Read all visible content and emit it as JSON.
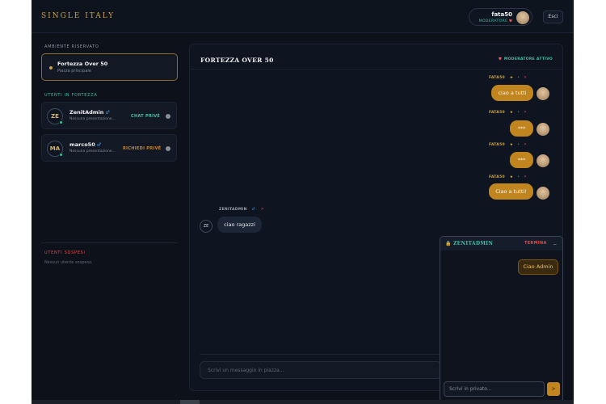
{
  "header": {
    "brand": "SINGLE ITALY",
    "user_name": "fata50",
    "user_role": "MODERATORE",
    "logout_label": "Esci"
  },
  "sidebar": {
    "room_section": "AMBIENTE RISERVATO",
    "room_name": "Fortezza Over 50",
    "room_sub": "Piazza principale",
    "users_section": "UTENTI IN FORTEZZA",
    "users": [
      {
        "initials": "ZE",
        "name": "ZenitAdmin",
        "gender": "♂",
        "desc": "Nessuna presentazione...",
        "action": "CHAT PRIVÉ"
      },
      {
        "initials": "MA",
        "name": "marco50",
        "gender": "♂",
        "desc": "Nessuna presentazione...",
        "action": "RICHIEDI PRIVÉ"
      }
    ],
    "suspended_section": "UTENTI SOSPESI",
    "suspended_empty": "Nessun utente sospeso."
  },
  "main": {
    "title": "FORTEZZA OVER 50",
    "mod_badge": "MODERATORE ATTIVO",
    "messages": [
      {
        "author": "FATA50",
        "text": "ciao a tutti"
      },
      {
        "author": "FATA50",
        "text": "***"
      },
      {
        "author": "FATA50",
        "text": "***"
      },
      {
        "author": "FATA50",
        "text": "Ciao a tutti!"
      },
      {
        "author": "ZENITADMIN",
        "text": "ciao ragazzi",
        "avatar": "ZE"
      }
    ],
    "input_placeholder": "Scrivi un messaggio in piazza..."
  },
  "private_chat": {
    "name": "ZENITADMIN",
    "end_label": "TERMINA",
    "minimize": "_",
    "message": "Ciao Admin",
    "input_placeholder": "Scrivi in privato...",
    "send": ">"
  },
  "icons": {
    "star": "★",
    "dot": "•",
    "close": "✕",
    "male": "♂",
    "lock": "🔒",
    "shield": "⛊"
  },
  "colors": {
    "gold": "#c8a04a",
    "teal": "#3ec0a6",
    "red": "#e04a4a",
    "bg": "#0c111a"
  }
}
